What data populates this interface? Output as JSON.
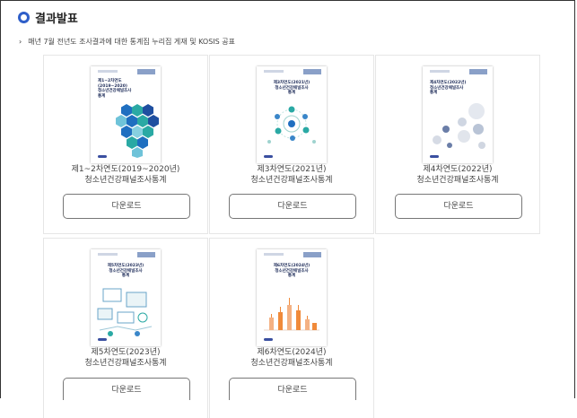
{
  "section": {
    "heading": "결과발표",
    "description": "매년 7월 전년도 조사결과에 대한 통계집 누리집 게재 및 KOSIS 공표",
    "bullet": "›"
  },
  "cards": [
    {
      "year_label": "제1~2차연도(2019~2020년)",
      "name": "청소년건강패널조사통계",
      "button": "다운로드",
      "cover_title": "제1~2차연도\n(2019~2020)\n청소년건강패널조사\n통계"
    },
    {
      "year_label": "제3차연도(2021년)",
      "name": "청소년건강패널조사통계",
      "button": "다운로드",
      "cover_title": "제3차연도(2021년)\n청소년건강패널조사\n통계"
    },
    {
      "year_label": "제4차연도(2022년)",
      "name": "청소년건강패널조사통계",
      "button": "다운로드",
      "cover_title": "제4차연도(2022년)\n청소년건강패널조사\n통계"
    },
    {
      "year_label": "제5차연도(2023년)",
      "name": "청소년건강패널조사통계",
      "button": "다운로드",
      "cover_title": "제5차연도(2023년)\n청소년건강패널조사\n통계"
    },
    {
      "year_label": "제6차연도(2024년)",
      "name": "청소년건강패널조사통계",
      "button": "다운로드",
      "cover_title": "제6차연도(2024년)\n청소년건강패널조사\n통계"
    }
  ],
  "colors": {
    "accent": "#2f5fc9",
    "hex_blue": "#1f6fc0",
    "hex_teal": "#2aa9a4",
    "bar_orange": "#f08a3a"
  }
}
